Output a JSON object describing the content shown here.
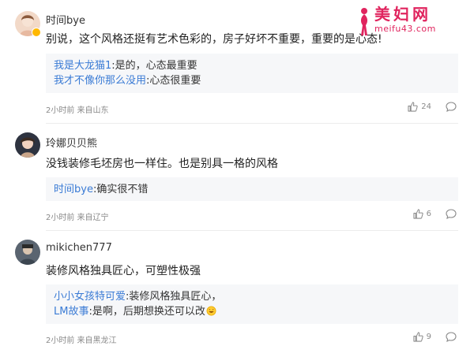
{
  "watermark": {
    "title": "美妇网",
    "url": "meifu43.com"
  },
  "comments": [
    {
      "username": "时间bye",
      "content": "别说，这个风格还挺有艺术色彩的，房子好坏不重要，重要的是心态!",
      "replies": [
        {
          "user": "我是大龙猫1",
          "text": ":是的，心态最重要"
        },
        {
          "user": "我才不像你那么没用",
          "text": ":心态很重要"
        }
      ],
      "meta": "2小时前 来自山东",
      "likes": "24"
    },
    {
      "username": "玲娜贝贝熊",
      "content": "没钱装修毛坯房也一样住。也是别具一格的风格",
      "replies": [
        {
          "user": "时间bye",
          "text": ":确实很不错"
        }
      ],
      "meta": "2小时前 来自辽宁",
      "likes": "6"
    },
    {
      "username": "mikichen777",
      "content": "装修风格独具匠心，可塑性极强",
      "replies": [
        {
          "user": "小小女孩特可爱",
          "text": ":装修风格独具匠心，"
        },
        {
          "user": "LM故事",
          "text": ":是啊，后期想换还可以改"
        }
      ],
      "meta": "2小时前 来自黑龙江",
      "likes": "9"
    }
  ],
  "icons": {
    "like": "thumbs-up-icon",
    "comment": "speech-bubble-icon",
    "badge": "verified-badge-icon",
    "emoji": "laughing-emoji-icon"
  },
  "colors": {
    "reply_user": "#3a7bd5",
    "watermark": "#e0245e",
    "badge": "#ffb800"
  }
}
